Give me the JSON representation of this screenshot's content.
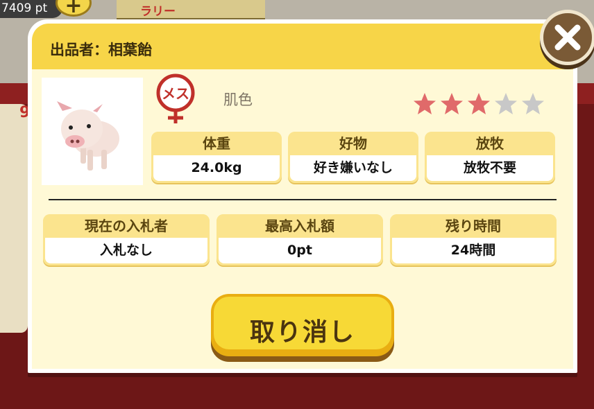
{
  "background": {
    "points": "7409 pt",
    "plus_icon": "plus-icon",
    "banner_text": "ラリー",
    "side_glyph": "9"
  },
  "dialog": {
    "title": "出品者：相葉飴",
    "close_icon": "close-icon"
  },
  "pig": {
    "icon": "pig-icon",
    "gender_label": "メス",
    "color": "肌色",
    "rating": 3,
    "rating_max": 5,
    "star_filled_color": "#e06a6a",
    "star_empty_color": "#c8c8c8"
  },
  "stats": [
    {
      "label": "体重",
      "value": "24.0kg"
    },
    {
      "label": "好物",
      "value": "好き嫌いなし"
    },
    {
      "label": "放牧",
      "value": "放牧不要"
    }
  ],
  "auction": [
    {
      "label": "現在の入札者",
      "value": "入札なし"
    },
    {
      "label": "最高入札額",
      "value": "0pt"
    },
    {
      "label": "残り時間",
      "value": "24時間"
    }
  ],
  "actions": {
    "cancel_label": "取り消し"
  },
  "colors": {
    "header": "#f7d548",
    "body": "#fff9d6",
    "accent_red": "#c0302a"
  }
}
